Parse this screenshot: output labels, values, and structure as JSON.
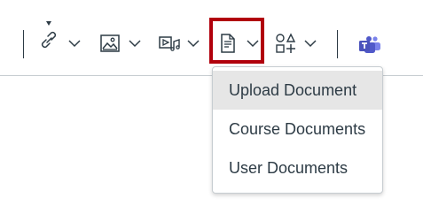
{
  "toolbar": {
    "tools": [
      {
        "icon": "link-icon",
        "has_dropdown": true
      },
      {
        "icon": "image-icon",
        "has_dropdown": true
      },
      {
        "icon": "media-icon",
        "has_dropdown": true
      },
      {
        "icon": "document-icon",
        "has_dropdown": true,
        "highlighted": true
      },
      {
        "icon": "apps-icon",
        "has_dropdown": true
      },
      {
        "icon": "teams-icon",
        "has_dropdown": false
      }
    ]
  },
  "document_menu": {
    "items": [
      {
        "label": "Upload Document",
        "active": true
      },
      {
        "label": "Course Documents",
        "active": false
      },
      {
        "label": "User Documents",
        "active": false
      }
    ]
  },
  "colors": {
    "icon": "#2d3b45",
    "highlight_border": "#b1000c",
    "menu_hover_bg": "#e6e6e6",
    "border": "#c7cdd1",
    "teams_purple": "#4b53bc"
  }
}
